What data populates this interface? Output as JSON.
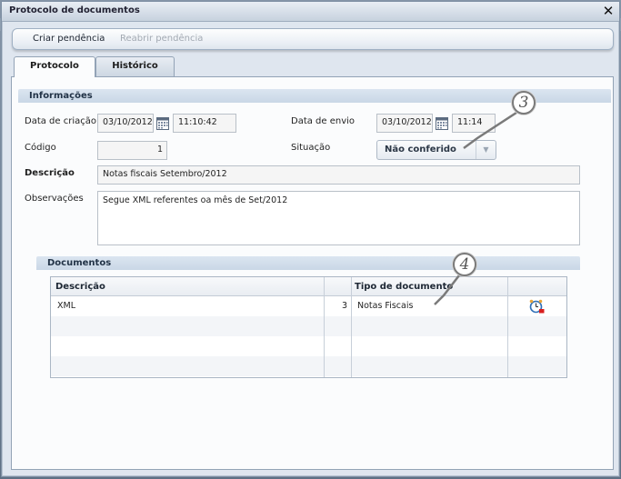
{
  "window": {
    "title": "Protocolo de documentos",
    "close_glyph": "✕"
  },
  "menu": {
    "create_pending": "Criar pendência",
    "reopen_pending": "Reabrir pendência"
  },
  "tabs": {
    "protocol": "Protocolo",
    "history": "Histórico"
  },
  "info": {
    "header": "Informações",
    "creation_date_label": "Data de criação",
    "creation_date": "03/10/2012",
    "creation_time": "11:10:42",
    "send_date_label": "Data de envio",
    "send_date": "03/10/2012",
    "send_time": "11:14",
    "code_label": "Código",
    "code": "1",
    "status_label": "Situação",
    "status": "Não conferido",
    "description_label": "Descrição",
    "description": "Notas fiscais Setembro/2012",
    "notes_label": "Observações",
    "notes": "Segue XML referentes oa mês de Set/2012"
  },
  "documents": {
    "header": "Documentos",
    "columns": {
      "description": "Descrição",
      "doc_type": "Tipo de documento"
    },
    "rows": [
      {
        "description": "XML",
        "qty": "3",
        "doc_type": "Notas Fiscais",
        "icon": "alarm-clock-icon"
      }
    ]
  },
  "callouts": {
    "c3": "3",
    "c4": "4"
  }
}
